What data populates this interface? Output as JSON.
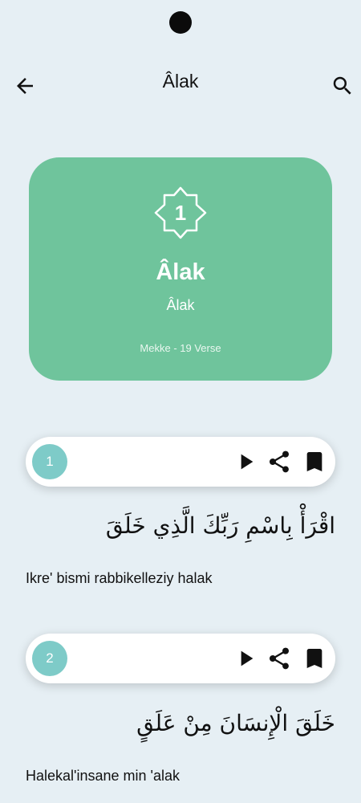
{
  "header": {
    "title": "Âlak",
    "back_icon": "arrow-back-icon",
    "search_icon": "search-icon"
  },
  "surah": {
    "number": "1",
    "name": "Âlak",
    "transliteration": "Âlak",
    "meta": "Mekke - 19 Verse"
  },
  "verses": [
    {
      "number": "1",
      "arabic": "اقْرَأْ بِاسْمِ رَبِّكَ الَّذِي خَلَقَ",
      "transliteration": "Ikre' bismi rabbikelleziy halak"
    },
    {
      "number": "2",
      "arabic": "خَلَقَ الْإِنسَانَ مِنْ عَلَقٍ",
      "transliteration": "Halekal'insane min 'alak"
    }
  ],
  "colors": {
    "card": "#6fc49c",
    "verse_badge": "#7ecbc8",
    "background": "#e6eff4"
  }
}
